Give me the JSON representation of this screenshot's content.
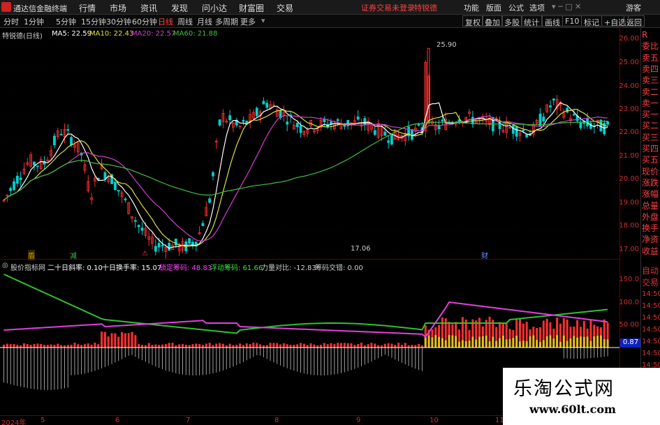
{
  "app": {
    "title": "通达信金融终端",
    "notice": "证券交易未登录",
    "stock_tag": "特锐德"
  },
  "menu": [
    "行情",
    "市场",
    "资讯",
    "发现",
    "问小达",
    "财富圈",
    "交易"
  ],
  "menu_right": [
    "功能",
    "版面",
    "公式",
    "选项",
    "游客"
  ],
  "periods": [
    "分时",
    "1分钟",
    "5分钟",
    "15分钟",
    "30分钟",
    "60分钟",
    "日线",
    "周线",
    "月线",
    "多周期",
    "更多"
  ],
  "active_period": "日线",
  "toolbar_right": [
    "复权",
    "叠加",
    "多股",
    "统计",
    "画线",
    "F10",
    "标记",
    "+自选",
    "返回"
  ],
  "main_legend": {
    "name": "特锐德(日线)",
    "ma5": "MA5: 22.59",
    "ma10": "MA10: 22.43",
    "ma20": "MA20: 22.57",
    "ma60": "MA60: 21.88"
  },
  "ind_legend": {
    "name": "股价指标网",
    "a": "二十日斜率: 0.10",
    "b": "十日换手率: 15.07",
    "c": "锁定筹码: 48.83",
    "d": "浮动筹码: 61.66",
    "e": "力量对比: -12.83",
    "f": "筹码交错: 0.00"
  },
  "price_labels": {
    "high": "25.90",
    "low": "17.06"
  },
  "event_marks": [
    "盾",
    "减",
    "⚠",
    "财"
  ],
  "price_axis": [
    "26.00",
    "25.00",
    "24.00",
    "23.00",
    "22.00",
    "21.00",
    "20.00",
    "19.00",
    "18.00",
    "17.00"
  ],
  "ind_axis": [
    "150.0",
    "100.0",
    "50.00"
  ],
  "ind_current": "0.87",
  "right_panel_top": [
    "R",
    "委比",
    "卖五",
    "卖四",
    "卖三",
    "卖二",
    "卖一",
    "买一",
    "买二",
    "买三",
    "买四",
    "买五",
    "现价",
    "涨跌",
    "涨幅",
    "总量",
    "外盘",
    "换手",
    "净资",
    "收益"
  ],
  "right_panel_bottom": [
    "自动",
    "交易",
    "14:50",
    "14:50",
    "14:50",
    "14:50",
    "14:50",
    "14:50",
    "14:50"
  ],
  "date_axis": [
    "2024年",
    "5",
    "6",
    "7",
    "8",
    "9",
    "10",
    "11"
  ],
  "watermark": {
    "cn": "乐淘公式网",
    "url": "www.60lt.com"
  },
  "colors": {
    "up": "#ff3030",
    "down": "#00d0d0",
    "ma5": "#ffffff",
    "ma10": "#e0e040",
    "ma20": "#d040d0",
    "ma60": "#40c040"
  }
}
